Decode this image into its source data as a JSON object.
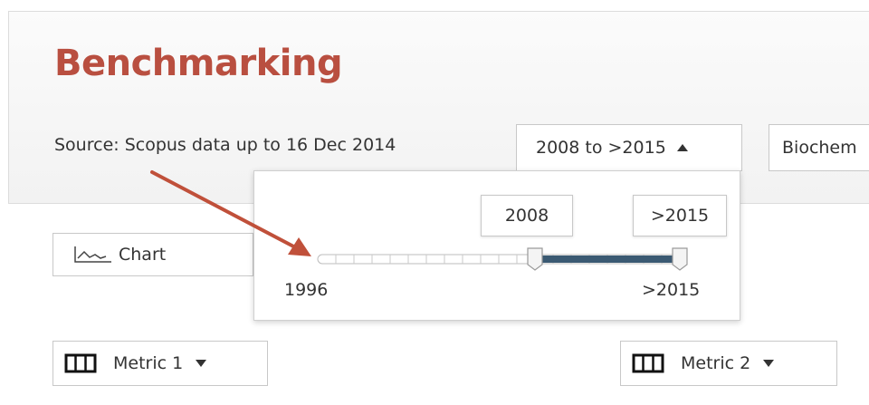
{
  "page": {
    "title": "Benchmarking"
  },
  "source": {
    "text": "Source: Scopus data up to 16 Dec 2014"
  },
  "year_dropdown": {
    "label": "2008 to >2015",
    "icon": "caret-up-icon"
  },
  "subject_dropdown": {
    "label": "Biochem"
  },
  "chart_button": {
    "label": "Chart",
    "icon": "line-chart-icon"
  },
  "year_slider": {
    "min_label": "1996",
    "max_label": ">2015",
    "selected_start": "2008",
    "selected_end": ">2015",
    "tick_count": 21,
    "start_index": 12,
    "end_index": 20
  },
  "metrics": [
    {
      "label": "Metric 1",
      "icon": "columns-icon"
    },
    {
      "label": "Metric 2",
      "icon": "columns-icon"
    }
  ],
  "colors": {
    "title": "#b94f40",
    "arrow": "#c0503a",
    "slider_range": "#3b5a73"
  }
}
